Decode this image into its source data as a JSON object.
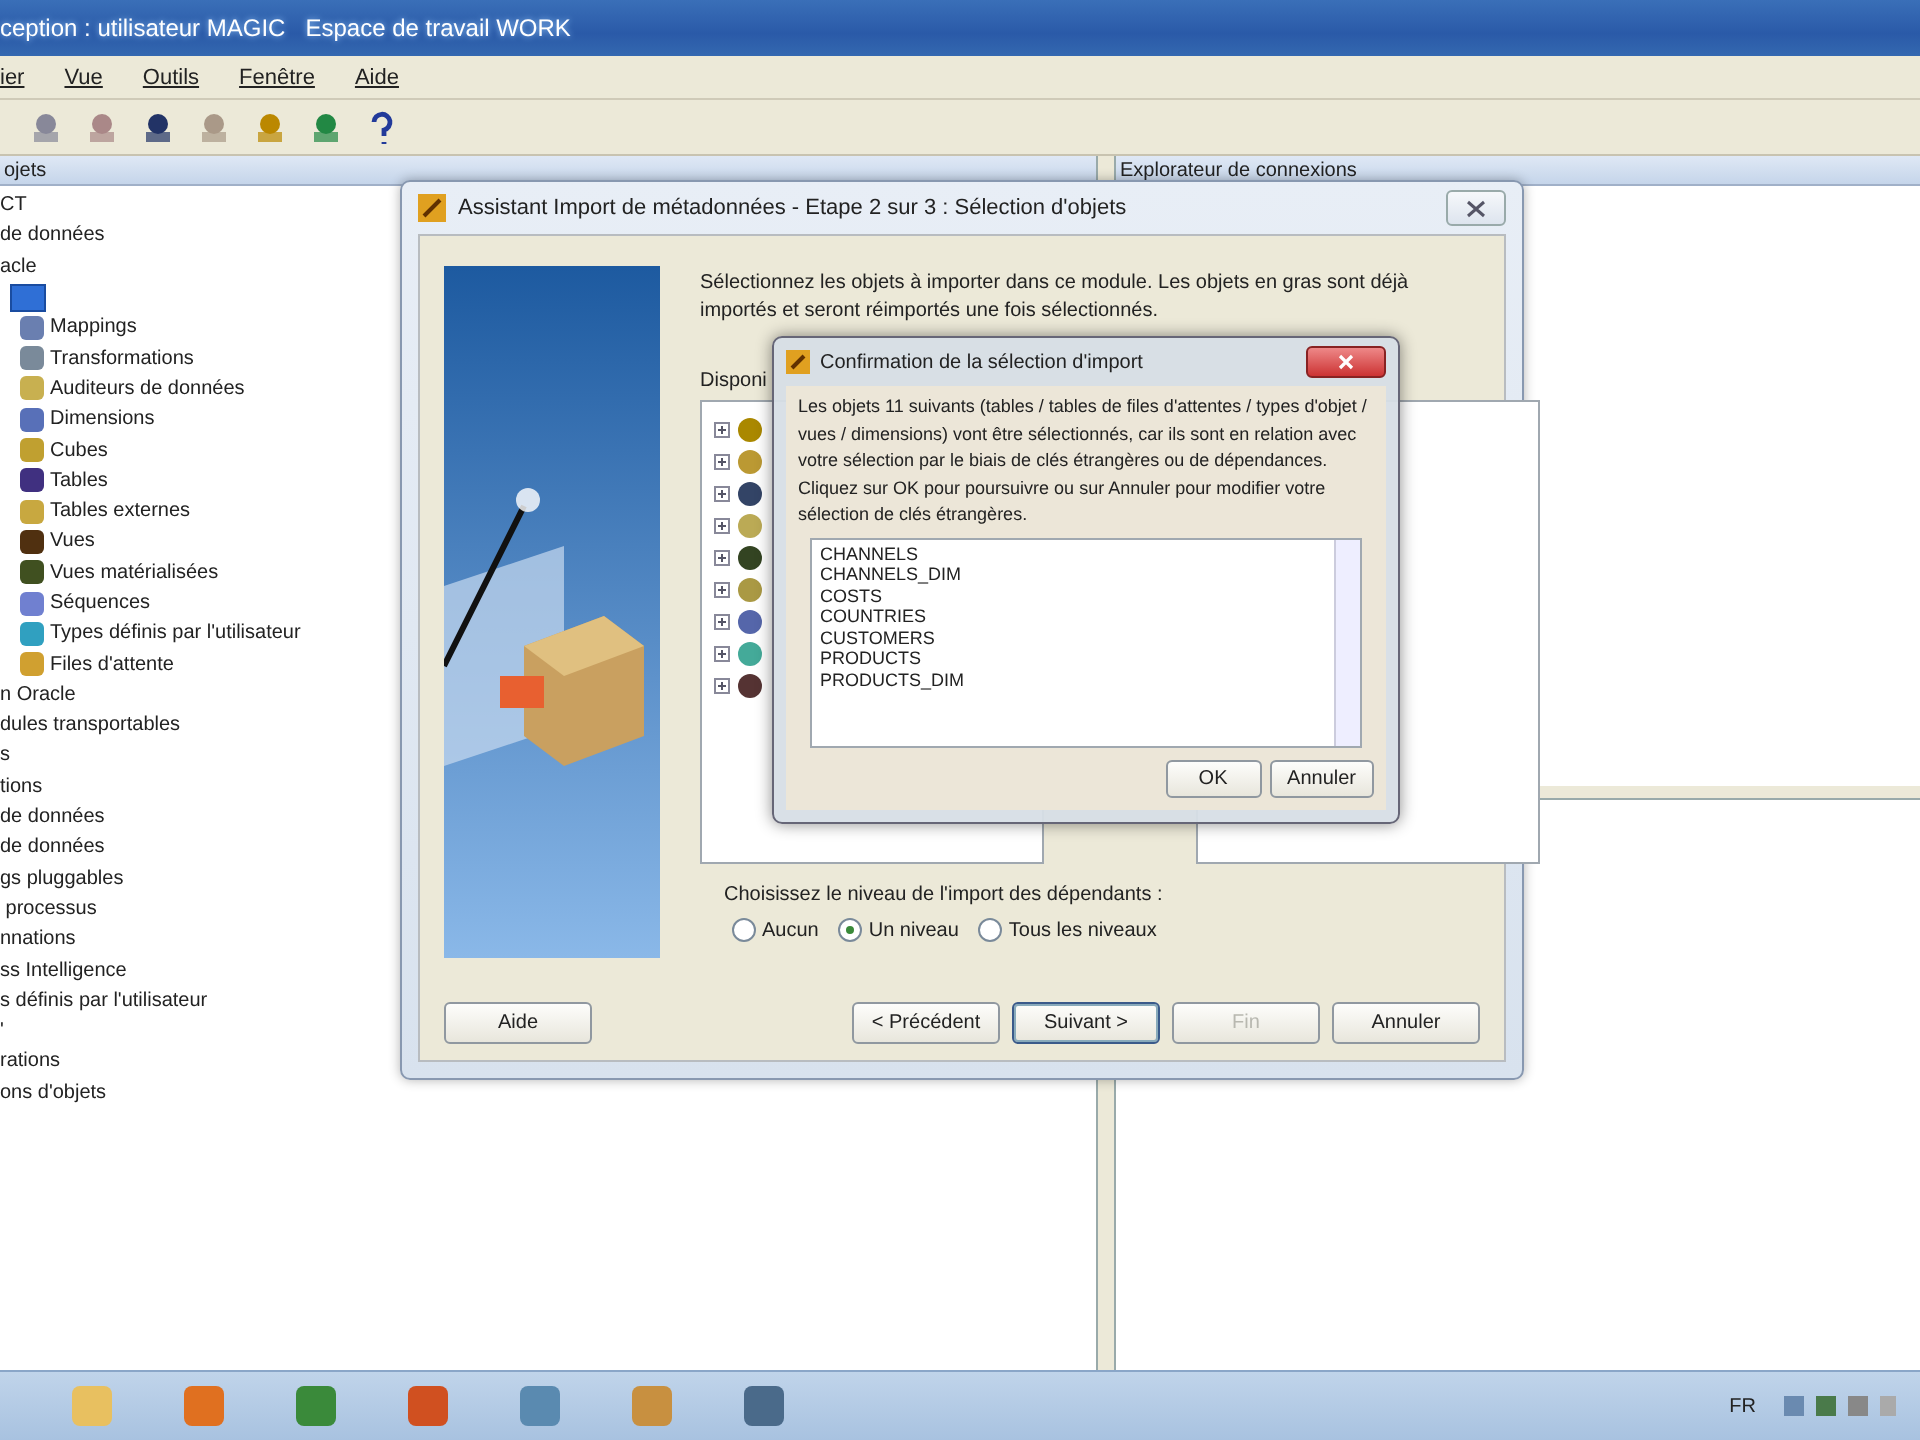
{
  "window": {
    "title": "ception : utilisateur MAGIC   Espace de travail WORK"
  },
  "menu": [
    {
      "label": "ier"
    },
    {
      "label": "Vue"
    },
    {
      "label": "Outils"
    },
    {
      "label": "Fenêtre"
    },
    {
      "label": "Aide"
    }
  ],
  "project_panel": {
    "title": "ojets",
    "tree": [
      {
        "label": "CT"
      },
      {
        "label": "de données"
      },
      {
        "label": "acle",
        "children": [
          {
            "kind": "module",
            "children": [
              {
                "label": "Mappings",
                "color": "#6a7fb0"
              },
              {
                "label": "Transformations",
                "color": "#7a8a9a"
              },
              {
                "label": "Auditeurs de données",
                "color": "#c8b050"
              },
              {
                "label": "Dimensions",
                "color": "#5870b8"
              },
              {
                "label": "Cubes",
                "color": "#c0a030"
              },
              {
                "label": "Tables",
                "color": "#403080"
              },
              {
                "label": "Tables externes",
                "color": "#c8a840"
              },
              {
                "label": "Vues",
                "color": "#503010"
              },
              {
                "label": "Vues matérialisées",
                "color": "#405020"
              },
              {
                "label": "Séquences",
                "color": "#7080d0"
              },
              {
                "label": "Types définis par l'utilisateur",
                "color": "#30a0c0"
              },
              {
                "label": "Files d'attente",
                "color": "#d0a030"
              }
            ]
          }
        ]
      },
      {
        "label": "n Oracle"
      },
      {
        "label": "dules transportables"
      },
      {
        "label": "s"
      },
      {
        "label": "tions"
      },
      {
        "label": "de données"
      },
      {
        "label": "de données"
      },
      {
        "label": "gs pluggables"
      },
      {
        "label": " processus"
      },
      {
        "label": "nnations"
      },
      {
        "label": "ss Intelligence"
      },
      {
        "label": "s définis par l'utilisateur"
      },
      {
        "label": "'"
      },
      {
        "label": "rations"
      },
      {
        "label": "ons d'objets"
      }
    ]
  },
  "connections_panel": {
    "title": "Explorateur de connexions"
  },
  "wizard": {
    "title": "Assistant Import de métadonnées - Etape 2 sur 3 : Sélection d'objets",
    "intro": "Sélectionnez les objets à importer dans ce module. Les objets en gras sont déjà importés et seront réimportés une fois sélectionnés.",
    "available_label": "Disponi",
    "dependency_level": {
      "label": "Choisissez le niveau de l'import des dépendants :",
      "options": [
        {
          "label": "Aucun",
          "selected": false
        },
        {
          "label": "Un niveau",
          "selected": true
        },
        {
          "label": "Tous les niveaux",
          "selected": false
        }
      ]
    },
    "help_button": "Aide",
    "buttons": [
      {
        "label": "< Précédent",
        "disabled": false,
        "focused": false
      },
      {
        "label": "Suivant >",
        "disabled": false,
        "focused": true
      },
      {
        "label": "Fin",
        "disabled": true,
        "focused": false
      },
      {
        "label": "Annuler",
        "disabled": false,
        "focused": false
      }
    ]
  },
  "confirmation": {
    "title": "Confirmation de la sélection d'import",
    "message": "Les objets 11 suivants (tables / tables de files d'attentes / types d'objet / vues / dimensions) vont être sélectionnés, car ils sont en relation avec votre sélection par le biais de clés étrangères ou de dépendances. Cliquez sur OK pour poursuivre ou sur Annuler pour modifier votre sélection de clés étrangères.",
    "objects": [
      "CHANNELS",
      "CHANNELS_DIM",
      "COSTS",
      "COUNTRIES",
      "CUSTOMERS",
      "PRODUCTS",
      "PRODUCTS_DIM"
    ],
    "buttons": [
      "OK",
      "Annuler"
    ]
  },
  "taskbar": {
    "language": "FR"
  }
}
